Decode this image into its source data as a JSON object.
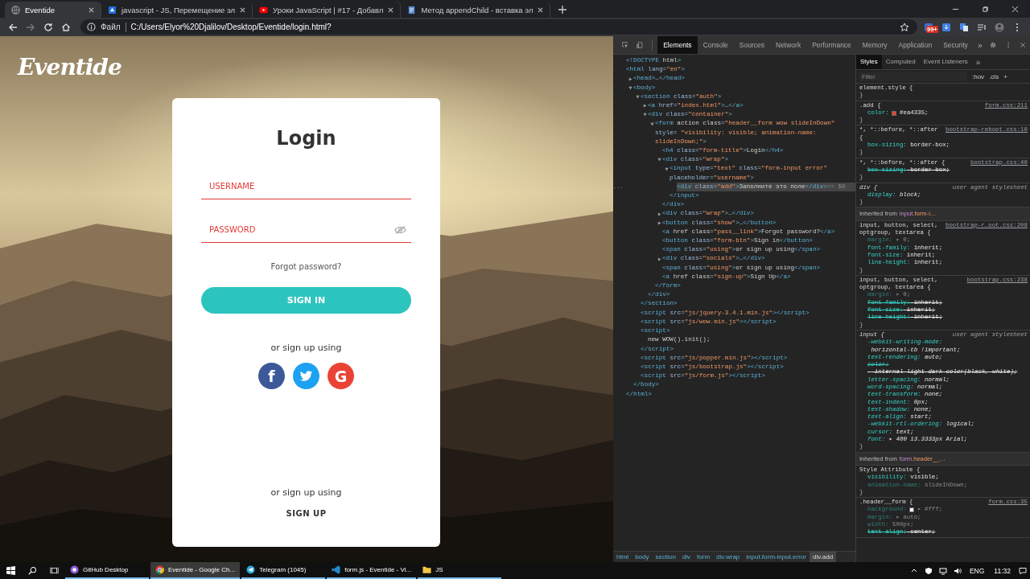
{
  "browser": {
    "tabs": [
      {
        "title": "Eventide",
        "selected": true
      },
      {
        "title": "javascript - JS, Перемещение эл",
        "selected": false
      },
      {
        "title": "Уроки JavaScript | #17 - Добавл",
        "selected": false
      },
      {
        "title": "Метод appendChild - вставка эл",
        "selected": false
      }
    ],
    "scheme_label": "Файл",
    "url": "C:/Users/Elyor%20Djalilov/Desktop/Eventide/login.html?",
    "badge": "99+"
  },
  "page": {
    "logo": "Eventide",
    "title": "Login",
    "fields": [
      {
        "placeholder": "USERNAME",
        "error": true,
        "kind": "text"
      },
      {
        "placeholder": "PASSWORD",
        "error": true,
        "kind": "password"
      }
    ],
    "forgot": "Forgot password?",
    "submit": "SIGN IN",
    "or1": "or sign up using",
    "socials": [
      {
        "kind": "letter",
        "label": "f",
        "color": "#3b5998"
      },
      {
        "kind": "bird",
        "color": "#1da1f2"
      },
      {
        "kind": "letter",
        "label": "G",
        "color": "#ea4335"
      }
    ],
    "or2": "or sign up using",
    "signup": "SIGN UP"
  },
  "devtools": {
    "tabs": [
      {
        "label": "Elements",
        "selected": true
      },
      {
        "label": "Console",
        "selected": false
      },
      {
        "label": "Sources",
        "selected": false
      },
      {
        "label": "Network",
        "selected": false
      },
      {
        "label": "Performance",
        "selected": false
      },
      {
        "label": "Memory",
        "selected": false
      },
      {
        "label": "Application",
        "selected": false
      },
      {
        "label": "Security",
        "selected": false
      }
    ],
    "more": "»",
    "dom": [
      {
        "kind": "leaf",
        "line": "<!DOCTYPE html>",
        "selected": false
      },
      {
        "kind": "root",
        "line": "<html lang=\"en\">",
        "close": "</html>",
        "selected": false,
        "children": [
          {
            "kind": "branch",
            "expanded": false,
            "line": "<head>…</head>",
            "selected": false
          },
          {
            "kind": "branch",
            "expanded": true,
            "line": "<body>",
            "close": "</body>",
            "selected": false,
            "children": [
              {
                "kind": "branch",
                "expanded": true,
                "line": "<section class=\"auth\">",
                "close": "</section>",
                "selected": false,
                "children": [
                  {
                    "kind": "branch",
                    "expanded": false,
                    "line": "<a href=\"index.html\">…</a>",
                    "selected": false
                  },
                  {
                    "kind": "branch",
                    "expanded": true,
                    "line": "<div class=\"container\">",
                    "close": "</div>",
                    "selected": false,
                    "children": [
                      {
                        "kind": "branch",
                        "expanded": true,
                        "line": "<form action class=\"header__form wow slideInDown\" style= \"visibility: visible; animation-name: slideInDown;\">",
                        "close": "</form>",
                        "selected": false,
                        "children": [
                          {
                            "kind": "leaf",
                            "line": "<h4 class=\"form-title\">Login</h4>",
                            "selected": false
                          },
                          {
                            "kind": "branch",
                            "expanded": true,
                            "line": "<div class=\"wrap\">",
                            "close": "</div>",
                            "selected": false,
                            "children": [
                              {
                                "kind": "branch",
                                "expanded": true,
                                "line": "<input type=\"text\" class=\"form-input error\" placeholder=\"username\">",
                                "close": "</input>",
                                "selected": false,
                                "children": [
                                  {
                                    "kind": "leaf",
                                    "line": "<div class=\"add\">Заполните это поле</div>",
                                    "suffix": "== $0",
                                    "gutter": "...",
                                    "selected": true
                                  }
                                ]
                              }
                            ]
                          },
                          {
                            "kind": "branch",
                            "expanded": false,
                            "line": "<div class=\"wrap\">…</div>",
                            "selected": false
                          },
                          {
                            "kind": "branch",
                            "expanded": false,
                            "line": "<button class=\"show\">…</button>",
                            "selected": false
                          },
                          {
                            "kind": "leaf",
                            "line": "<a href class=\"pass__link\">Forgot password?</a>",
                            "selected": false
                          },
                          {
                            "kind": "leaf",
                            "line": "<button class=\"form-btn\">Sign in</button>",
                            "selected": false
                          },
                          {
                            "kind": "leaf",
                            "line": "<span class=\"using\">or sign up using</span>",
                            "selected": false
                          },
                          {
                            "kind": "branch",
                            "expanded": false,
                            "line": "<div class=\"socials\">…</div>",
                            "selected": false
                          },
                          {
                            "kind": "leaf",
                            "line": "<span class=\"using\">or sign up using</span>",
                            "selected": false
                          },
                          {
                            "kind": "leaf",
                            "line": "<a href class=\"sign-up\">Sign Up</a>",
                            "selected": false
                          }
                        ]
                      }
                    ]
                  }
                ]
              },
              {
                "kind": "leaf",
                "line": "<script src=\"js/jquery-3.4.1.min.js\"></script>",
                "selected": false
              },
              {
                "kind": "leaf",
                "line": "<script src=\"js/wow.min.js\"></script>",
                "selected": false
              },
              {
                "kind": "root",
                "line": "<script>",
                "close": "</script>",
                "selected": false,
                "children": [
                  {
                    "kind": "leaf",
                    "line": "new WOW().init();",
                    "selected": false
                  }
                ]
              },
              {
                "kind": "leaf",
                "line": "<script src=\"js/popper.min.js\"></script>",
                "selected": false
              },
              {
                "kind": "leaf",
                "line": "<script src=\"js/bootstrap.js\"></script>",
                "selected": false
              },
              {
                "kind": "leaf",
                "line": "<script src=\"js/form.js\"></script>",
                "selected": false
              }
            ]
          }
        ]
      }
    ],
    "breadcrumbs": [
      {
        "label": "html",
        "selected": false
      },
      {
        "label": "body",
        "selected": false
      },
      {
        "label": "section",
        "selected": false
      },
      {
        "label": "div",
        "selected": false
      },
      {
        "label": "form",
        "selected": false
      },
      {
        "label": "div.wrap",
        "selected": false
      },
      {
        "label": "input.form-input.error",
        "selected": false
      },
      {
        "label": "div.add",
        "selected": true
      }
    ],
    "side_tabs": [
      {
        "label": "Styles",
        "selected": true
      },
      {
        "label": "Computed",
        "selected": false
      },
      {
        "label": "Event Listeners",
        "selected": false
      }
    ],
    "side_more": "»",
    "filter_placeholder": "Filter",
    "hov": ":hov",
    "cls": ".cls",
    "plus": "+",
    "rules": [
      {
        "kind": "rule",
        "open": "element.style {",
        "close": "}"
      },
      {
        "kind": "rule",
        "open": ".add {",
        "source": "form.css:211",
        "close": "}",
        "props": [
          {
            "text": "color: #ea4335;",
            "swatch": true,
            "struck": false,
            "inactive": false
          }
        ]
      },
      {
        "kind": "rule",
        "open": "*, *::before, *::after {",
        "source": "bootstrap-reboot.css:10",
        "close": "}",
        "props": [
          {
            "text": "box-sizing: border-box;",
            "struck": false,
            "inactive": false
          }
        ]
      },
      {
        "kind": "rule",
        "open": "*, *::before, *::after {",
        "source": "bootstrap.css:40",
        "close": "}",
        "props": [
          {
            "text": "box-sizing: border-box;",
            "struck": true,
            "inactive": false
          }
        ]
      },
      {
        "kind": "rule",
        "open": "div {",
        "source": "user agent stylesheet",
        "user_agent": true,
        "close": "}",
        "props": [
          {
            "text": "display: block;",
            "struck": false,
            "inactive": false
          }
        ]
      },
      {
        "kind": "inherited",
        "label": "Inherited from",
        "tag": "input",
        "cls": ".form-i…"
      },
      {
        "kind": "rule",
        "open": "input, button, select, optgroup, textarea {",
        "source": "bootstrap-r…oot.css:208",
        "close": "}",
        "props": [
          {
            "text": "margin: ▸ 0;",
            "struck": false,
            "inactive": true
          },
          {
            "text": "font-family: inherit;",
            "struck": false,
            "inactive": false
          },
          {
            "text": "font-size: inherit;",
            "struck": false,
            "inactive": false
          },
          {
            "text": "line-height: inherit;",
            "struck": false,
            "inactive": false
          }
        ]
      },
      {
        "kind": "rule",
        "open": "input, button, select, optgroup, textarea {",
        "source": "bootstrap.css:238",
        "close": "}",
        "props": [
          {
            "text": "margin: ▸ 0;",
            "struck": false,
            "inactive": true
          },
          {
            "text": "font-family: inherit;",
            "struck": true,
            "inactive": false
          },
          {
            "text": "font-size: inherit;",
            "struck": true,
            "inactive": false
          },
          {
            "text": "line-height: inherit;",
            "struck": true,
            "inactive": false
          }
        ]
      },
      {
        "kind": "rule",
        "open": "input {",
        "source": "user agent stylesheet",
        "user_agent": true,
        "close": "}",
        "props": [
          {
            "text": "-webkit-writing-mode: horizontal-tb !important;",
            "struck": false,
            "inactive": false
          },
          {
            "text": "text-rendering: auto;",
            "struck": false,
            "inactive": false
          },
          {
            "text": "color: -internal-light-dark-color(black, white);",
            "struck": true,
            "inactive": false
          },
          {
            "text": "letter-spacing: normal;",
            "struck": false,
            "inactive": false
          },
          {
            "text": "word-spacing: normal;",
            "struck": false,
            "inactive": false
          },
          {
            "text": "text-transform: none;",
            "struck": false,
            "inactive": false
          },
          {
            "text": "text-indent: 0px;",
            "struck": false,
            "inactive": false
          },
          {
            "text": "text-shadow: none;",
            "struck": false,
            "inactive": false
          },
          {
            "text": "text-align: start;",
            "struck": false,
            "inactive": false
          },
          {
            "text": "-webkit-rtl-ordering: logical;",
            "struck": false,
            "inactive": false
          },
          {
            "text": "cursor: text;",
            "struck": false,
            "inactive": false
          },
          {
            "text": "font: ▸ 400 13.3333px Arial;",
            "struck": false,
            "inactive": false
          }
        ]
      },
      {
        "kind": "inherited",
        "label": "Inherited from",
        "tag": "form",
        "cls": ".header__…"
      },
      {
        "kind": "rule",
        "open": "Style Attribute {",
        "close": "}",
        "props": [
          {
            "text": "visibility: visible;",
            "struck": false,
            "inactive": false
          },
          {
            "text": "animation-name: slideInDown;",
            "struck": false,
            "inactive": true
          }
        ]
      },
      {
        "kind": "rule",
        "open": ".header__form {",
        "source": "form.css:35",
        "props": [
          {
            "text": "background: ▸ #fff;",
            "swatch": true,
            "struck": false,
            "inactive": true
          },
          {
            "text": "margin: ▸ auto;",
            "struck": false,
            "inactive": true
          },
          {
            "text": "width: 500px;",
            "struck": false,
            "inactive": true
          },
          {
            "text": "text-align: center;",
            "struck": true,
            "inactive": false
          }
        ]
      }
    ]
  },
  "taskbar": {
    "apps": [
      {
        "label": "GitHub Desktop",
        "selected": false
      },
      {
        "label": "Eventide - Google Ch...",
        "selected": true
      },
      {
        "label": "Telegram (1045)",
        "selected": false
      },
      {
        "label": "form.js - Eventide - Vi...",
        "selected": false
      },
      {
        "label": "JS",
        "selected": false
      }
    ],
    "lang": "ENG",
    "time": "11:32"
  }
}
